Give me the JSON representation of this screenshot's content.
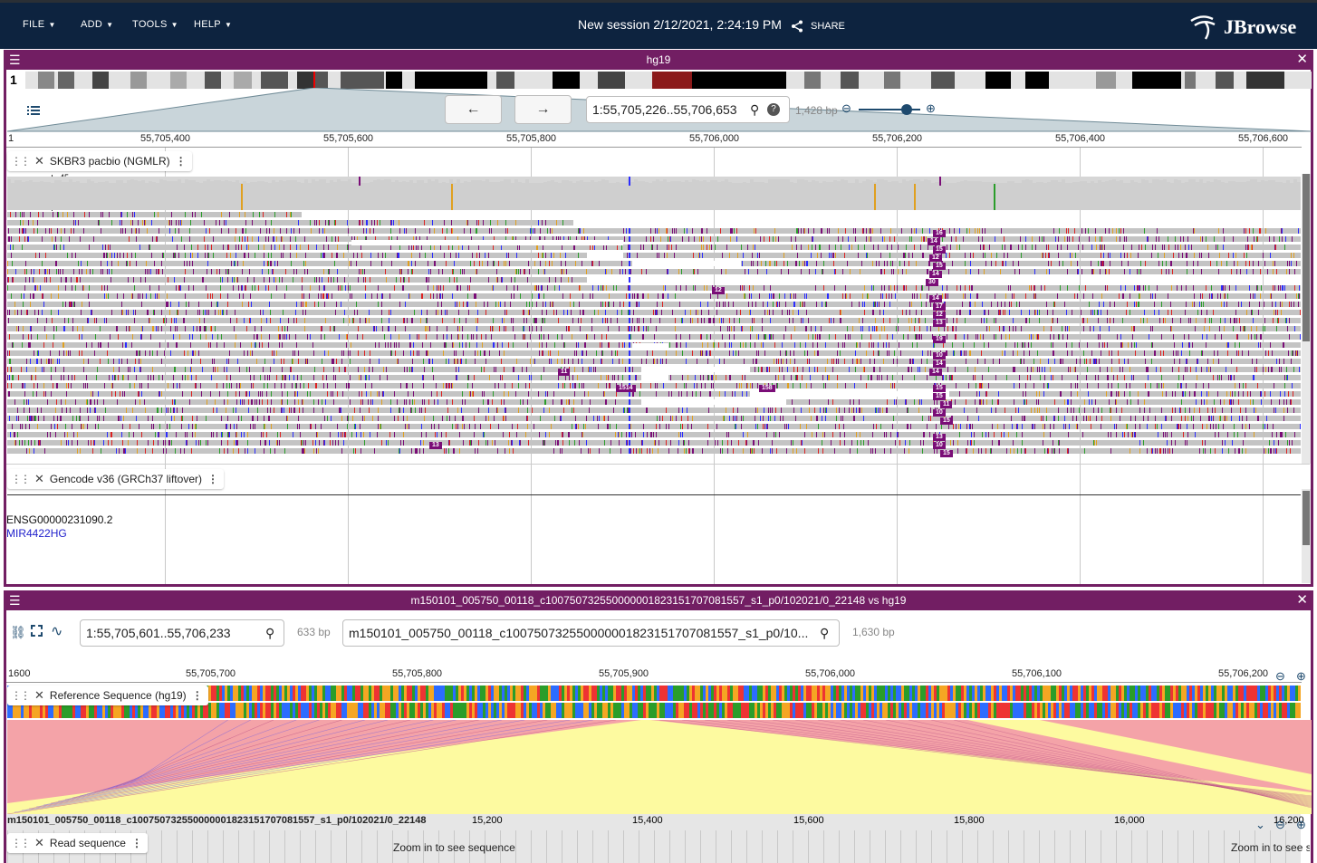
{
  "appbar": {
    "menus": [
      "FILE",
      "ADD",
      "TOOLS",
      "HELP"
    ],
    "session_title": "New session 2/12/2021, 2:24:19 PM",
    "share_label": "SHARE",
    "logo_text": "JBrowse"
  },
  "view1": {
    "title": "hg19",
    "chromosome": "1",
    "location": "1:55,705,226..55,706,653",
    "span": "1,428 bp",
    "ruler_ticks": [
      "1",
      "55,705,400",
      "55,705,600",
      "55,705,800",
      "55,706,000",
      "55,706,200",
      "55,706,400",
      "55,706,600"
    ],
    "tracks": {
      "alignments": {
        "name": "SKBR3 pacbio (NGMLR)",
        "coverage_max": "45",
        "coverage_min": "0",
        "insertion_labels": [
          "16",
          "14",
          "15",
          "12",
          "15",
          "14",
          "30",
          "12",
          "14",
          "17",
          "12",
          "13",
          "19",
          "10",
          "14",
          "11",
          "14",
          "1514",
          "158",
          "15",
          "15",
          "11",
          "10",
          "15",
          "13",
          "10",
          "13",
          "15"
        ]
      },
      "genes": {
        "name": "Gencode v36 (GRCh37 liftover)",
        "feature_id": "ENSG00000231090.2",
        "feature_name": "MIR4422HG"
      }
    }
  },
  "view2": {
    "title": "m150101_005750_00118_c100750732550000001823151707081557_s1_p0/102021/0_22148 vs hg19",
    "top_location": "1:55,705,601..55,706,233",
    "top_span": "633 bp",
    "bottom_location": "m150101_005750_00118_c100750732550000001823151707081557_s1_p0/10...",
    "bottom_span": "1,630 bp",
    "top_ruler_ticks": [
      "1600",
      "55,705,700",
      "55,705,800",
      "55,705,900",
      "55,706,000",
      "55,706,100",
      "55,706,200"
    ],
    "ref_track_name": "Reference Sequence (hg19)",
    "bottom_ruler_label": "m150101_005750_00118_c100750732550000001823151707081557_s1_p0/102021/0_22148",
    "bottom_ruler_ticks": [
      "15,200",
      "15,400",
      "15,600",
      "15,800",
      "16,000",
      "16,200"
    ],
    "read_track_name": "Read sequence",
    "zoom_msg": "Zoom in to see sequence",
    "zoom_msg_cut": "Zoom in to see s"
  },
  "colors": {
    "appbar": "#0d233f",
    "view_header": "#721e63",
    "insertion": "#7a0d77",
    "synteny_pink": "#f4a3a8",
    "synteny_yellow": "#fdfaa0"
  }
}
